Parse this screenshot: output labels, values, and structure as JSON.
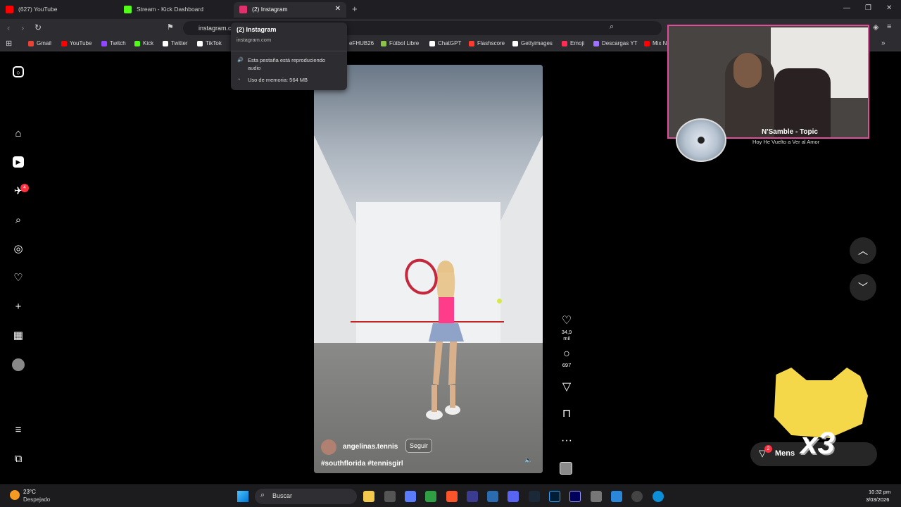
{
  "browser": {
    "tabs": [
      {
        "label": "(627) YouTube",
        "color": "#ff0000"
      },
      {
        "label": "Stream - Kick Dashboard",
        "color": "#53fc18"
      },
      {
        "label": "(2) Instagram",
        "color": "#e1306c"
      }
    ],
    "address": "instagram.c",
    "bookmarks": [
      {
        "label": "Gmail",
        "color": "#ea4335"
      },
      {
        "label": "YouTube",
        "color": "#ff0000"
      },
      {
        "label": "Twitch",
        "color": "#9146ff"
      },
      {
        "label": "Kick",
        "color": "#53fc18"
      },
      {
        "label": "Twitter",
        "color": "#ffffff"
      },
      {
        "label": "TikTok",
        "color": "#ffffff"
      },
      {
        "label": "eFHUB26",
        "color": "#00aaff"
      },
      {
        "label": "Fútbol Libre",
        "color": "#8bc34a"
      },
      {
        "label": "ChatGPT",
        "color": "#ffffff"
      },
      {
        "label": "Flashscore",
        "color": "#ff3b30"
      },
      {
        "label": "Gettyimages",
        "color": "#ffffff"
      },
      {
        "label": "Emoji",
        "color": "#ff2d55"
      },
      {
        "label": "Descargas YT",
        "color": "#a070ff"
      },
      {
        "label": "Mix N",
        "color": "#ff0000"
      }
    ]
  },
  "tooltip": {
    "title": "(2) Instagram",
    "domain": "instagram.com",
    "audio": "Esta pestaña está reproduciendo audio",
    "memory": "Uso de memoria: 564 MB"
  },
  "sidebar": {
    "notifications_badge": "4"
  },
  "reel": {
    "author": "angelinas.tennis",
    "follow": "Seguir",
    "caption": "#southflorida #tennisgirl",
    "likes": "34,9 mil",
    "comments": "697"
  },
  "overlay": {
    "music_title": "N'Samble - Topic",
    "music_subtitle": "Hoy He Vuelto a Ver al Amor",
    "cat_multiplier": "x3"
  },
  "messages": {
    "label": "Mens",
    "badge": "2"
  },
  "taskbar": {
    "temperature": "23°C",
    "weather": "Despejado",
    "search": "Buscar",
    "time": "10:32 pm",
    "date": "3/03/2026"
  }
}
